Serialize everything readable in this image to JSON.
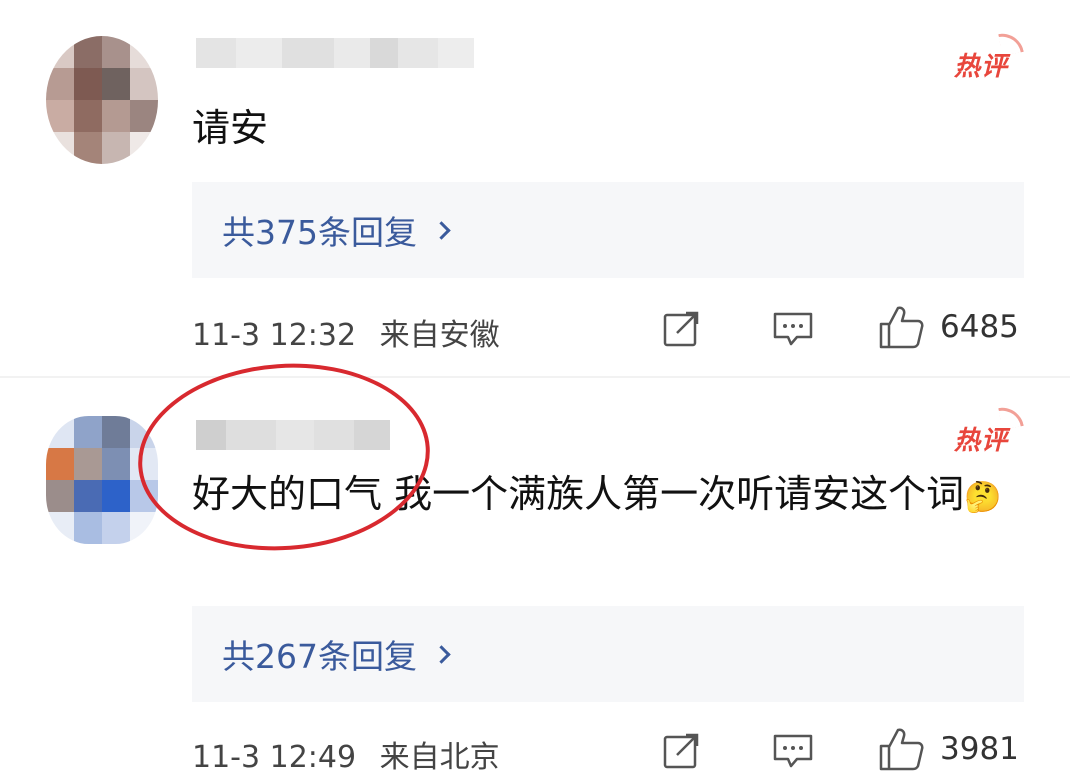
{
  "comments": [
    {
      "badge": "热评",
      "text": "请安",
      "replies": "共375条回复",
      "time": "11-3 12:32",
      "location": "来自安徽",
      "likes": "6485"
    },
    {
      "badge": "热评",
      "text": "好大的口气 我一个满族人第一次听请安这个词",
      "emoji": "🤔",
      "replies": "共267条回复",
      "time": "11-3 12:49",
      "location": "来自北京",
      "likes": "3981"
    }
  ],
  "icons": [
    "share-icon",
    "comment-icon",
    "like-icon"
  ],
  "colors": {
    "badge": "#e8463c",
    "reply_link": "#3a5a9c",
    "annotation_circle": "#d8292f",
    "reply_box_bg": "#f6f7f9"
  }
}
